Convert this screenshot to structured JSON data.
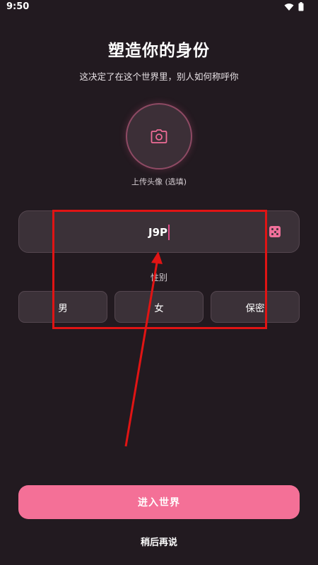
{
  "status_bar": {
    "time": "9:50",
    "icons": [
      "wifi-icon",
      "battery-icon"
    ]
  },
  "header": {
    "title": "塑造你的身份",
    "subtitle": "这决定了在这个世界里，别人如何称呼你"
  },
  "avatar": {
    "icon": "camera-icon",
    "label": "上传头像 (选填)"
  },
  "name_input": {
    "value": "J9P",
    "random_icon": "dice-icon"
  },
  "gender": {
    "label": "性别",
    "options": [
      "男",
      "女",
      "保密"
    ]
  },
  "actions": {
    "enter_label": "进入世界",
    "later_label": "稍后再说"
  },
  "colors": {
    "background": "#221a20",
    "accent": "#f47097",
    "field": "#3b3138",
    "annotation": "#e01414"
  }
}
